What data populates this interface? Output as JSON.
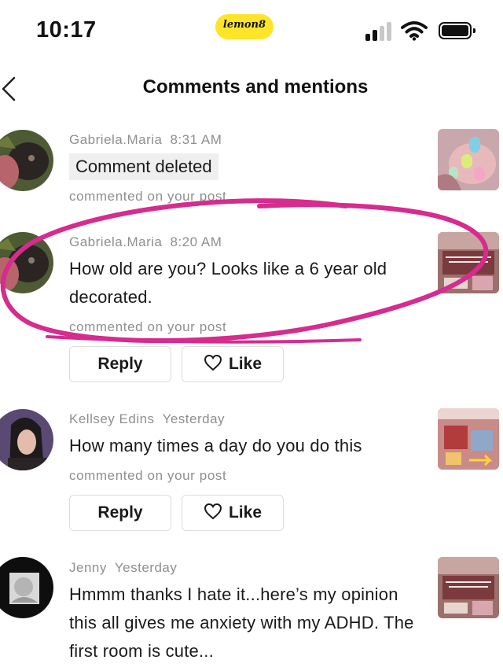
{
  "status_bar": {
    "time": "10:17",
    "brand": "lemon8",
    "brand_color": "#ffe52a"
  },
  "header": {
    "back_icon": "chevron-left-icon",
    "title": "Comments and mentions"
  },
  "comments": [
    {
      "author": "Gabriela.Maria",
      "time": "8:31 AM",
      "text": "Comment deleted",
      "deleted": true,
      "subtitle": "commented on your post"
    },
    {
      "author": "Gabriela.Maria",
      "time": "8:20 AM",
      "text": "How old are you? Looks like a 6 year old decorated.",
      "subtitle": "commented on your post",
      "reply_label": "Reply",
      "like_label": "Like"
    },
    {
      "author": "Kellsey Edins",
      "time": "Yesterday",
      "text": "How many times a day do you do this",
      "subtitle": "commented on your post",
      "reply_label": "Reply",
      "like_label": "Like"
    },
    {
      "author": "Jenny",
      "time": "Yesterday",
      "text": "Hmmm thanks I hate it...here’s my opinion this all gives me anxiety with my ADHD. The first room is cute..."
    }
  ],
  "annotation_color": "#d62b8f"
}
